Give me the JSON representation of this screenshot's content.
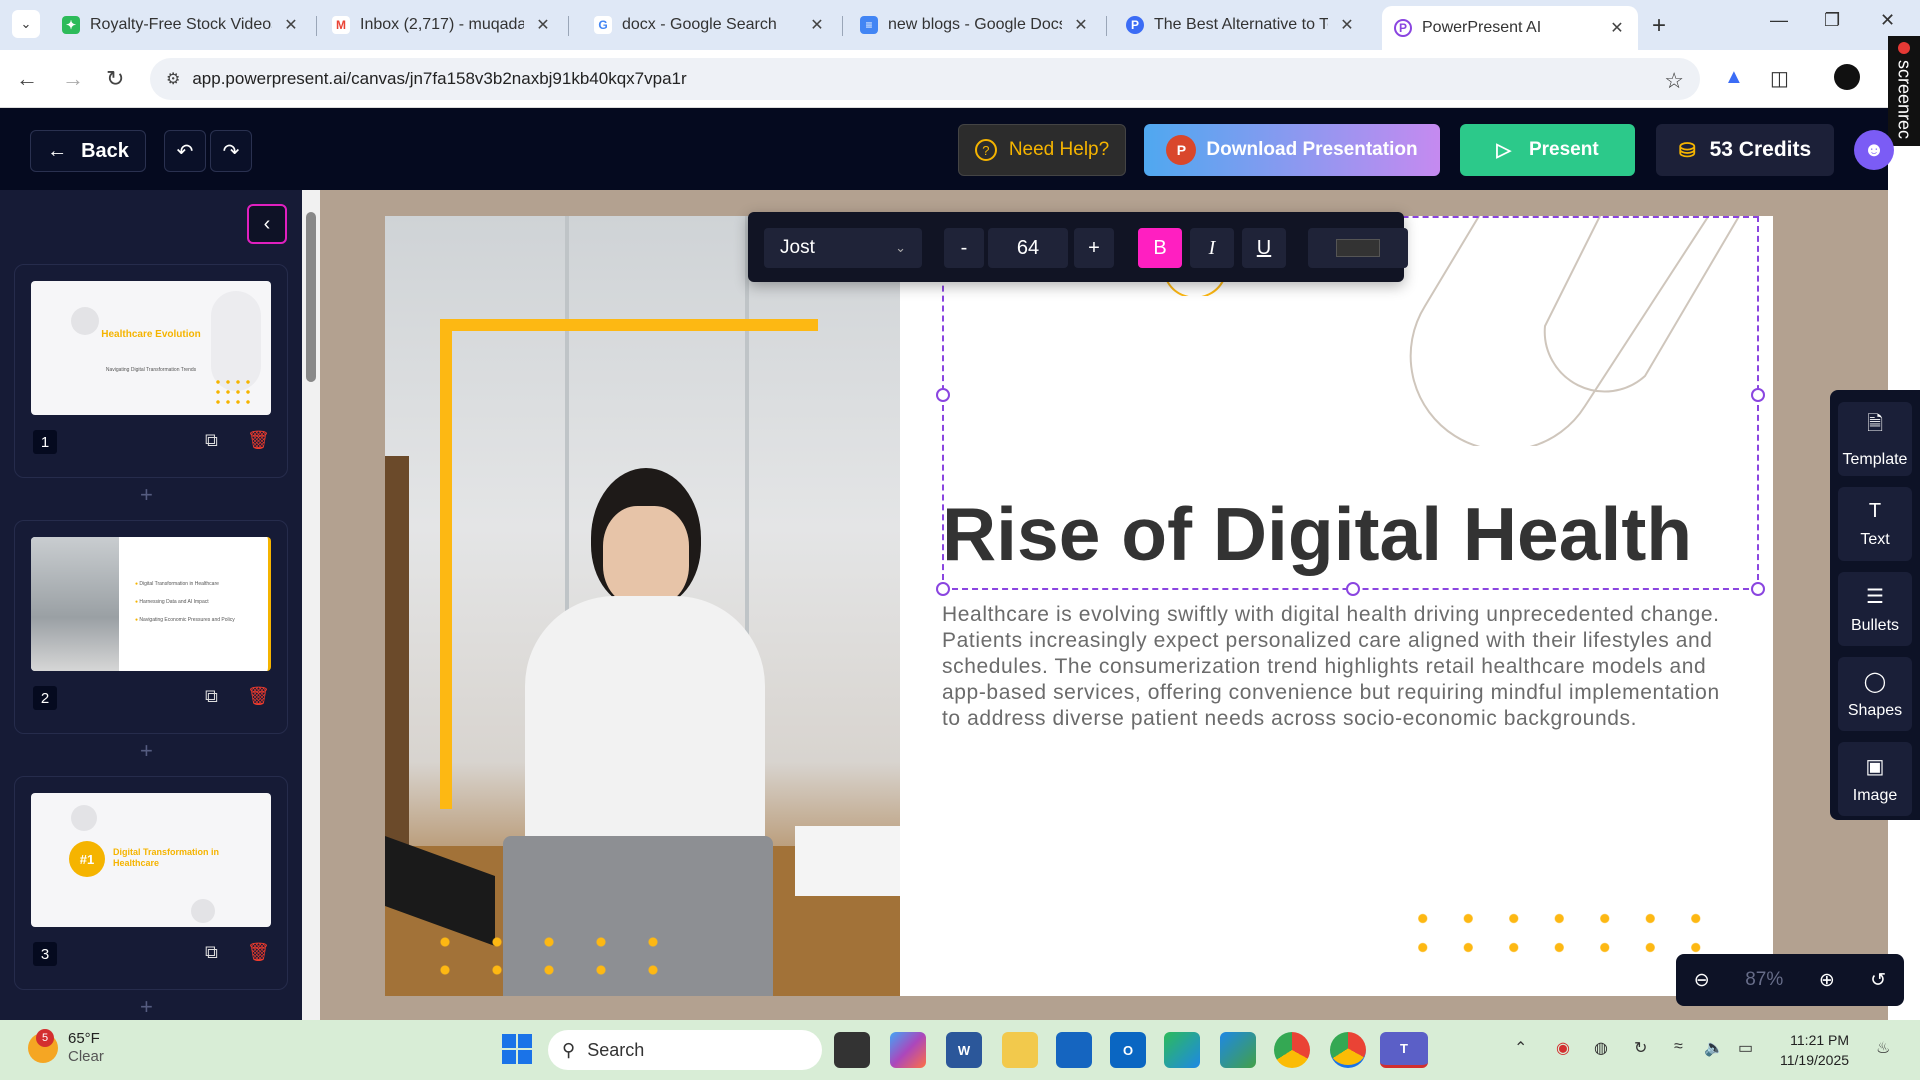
{
  "browser": {
    "tabs": [
      {
        "title": "Royalty-Free Stock Videos",
        "favicon": "storyblocks-icon",
        "color": "#2dbb5a"
      },
      {
        "title": "Inbox (2,717) - muqadasib...",
        "favicon": "gmail-icon",
        "color": "#ea4335"
      },
      {
        "title": "docx - Google Search",
        "favicon": "google-icon",
        "color": "#4285f4"
      },
      {
        "title": "new blogs - Google Docs",
        "favicon": "docs-icon",
        "color": "#4285f4"
      },
      {
        "title": "The Best Alternative to Tom...",
        "favicon": "p-icon",
        "color": "#3b6cf5"
      },
      {
        "title": "PowerPresent AI",
        "favicon": "powerpresent-icon",
        "color": "#8a45e0"
      }
    ],
    "url": "app.powerpresent.ai/canvas/jn7fa158v3b2naxbj91kb40kqx7vpa1r",
    "screenrec_label": "screenrec"
  },
  "header": {
    "back_label": "Back",
    "help_label": "Need Help?",
    "download_label": "Download Presentation",
    "present_label": "Present",
    "credits_label": "53 Credits",
    "accent": "#2cc98a"
  },
  "slides": [
    {
      "number": "1",
      "thumb_title": "Healthcare Evolution",
      "thumb_sub": "Navigating Digital Transformation Trends"
    },
    {
      "number": "2",
      "thumb_items": [
        "Digital Transformation in Healthcare",
        "Harnessing Data and AI Impact",
        "Navigating Economic Pressures and Policy"
      ]
    },
    {
      "number": "3",
      "thumb_badge": "#1",
      "thumb_title": "Digital Transformation in Healthcare"
    }
  ],
  "format_toolbar": {
    "font": "Jost",
    "minus": "-",
    "size": "64",
    "plus": "+",
    "bold": "B",
    "italic": "I",
    "underline": "U",
    "bold_color": "#ff1fc1"
  },
  "slide_content": {
    "title": "Rise of Digital Health",
    "body": "Healthcare is evolving swiftly with digital health driving unprecedented change. Patients increasingly expect personalized care aligned with their lifestyles and schedules. The consumerization trend highlights retail healthcare models and app-based services, offering convenience but requiring mindful implementation to address diverse patient needs across socio-economic backgrounds.",
    "accent": "#fdb813"
  },
  "tools": [
    {
      "label": "Template",
      "icon": "document-icon"
    },
    {
      "label": "Text",
      "icon": "text-icon"
    },
    {
      "label": "Bullets",
      "icon": "list-icon"
    },
    {
      "label": "Shapes",
      "icon": "circle-icon"
    },
    {
      "label": "Image",
      "icon": "image-icon"
    }
  ],
  "zoom": {
    "value": "87%"
  },
  "taskbar": {
    "weather_temp": "65°F",
    "weather_desc": "Clear",
    "weather_badge": "5",
    "search_label": "Search",
    "time": "11:21 PM",
    "date": "11/19/2025"
  }
}
